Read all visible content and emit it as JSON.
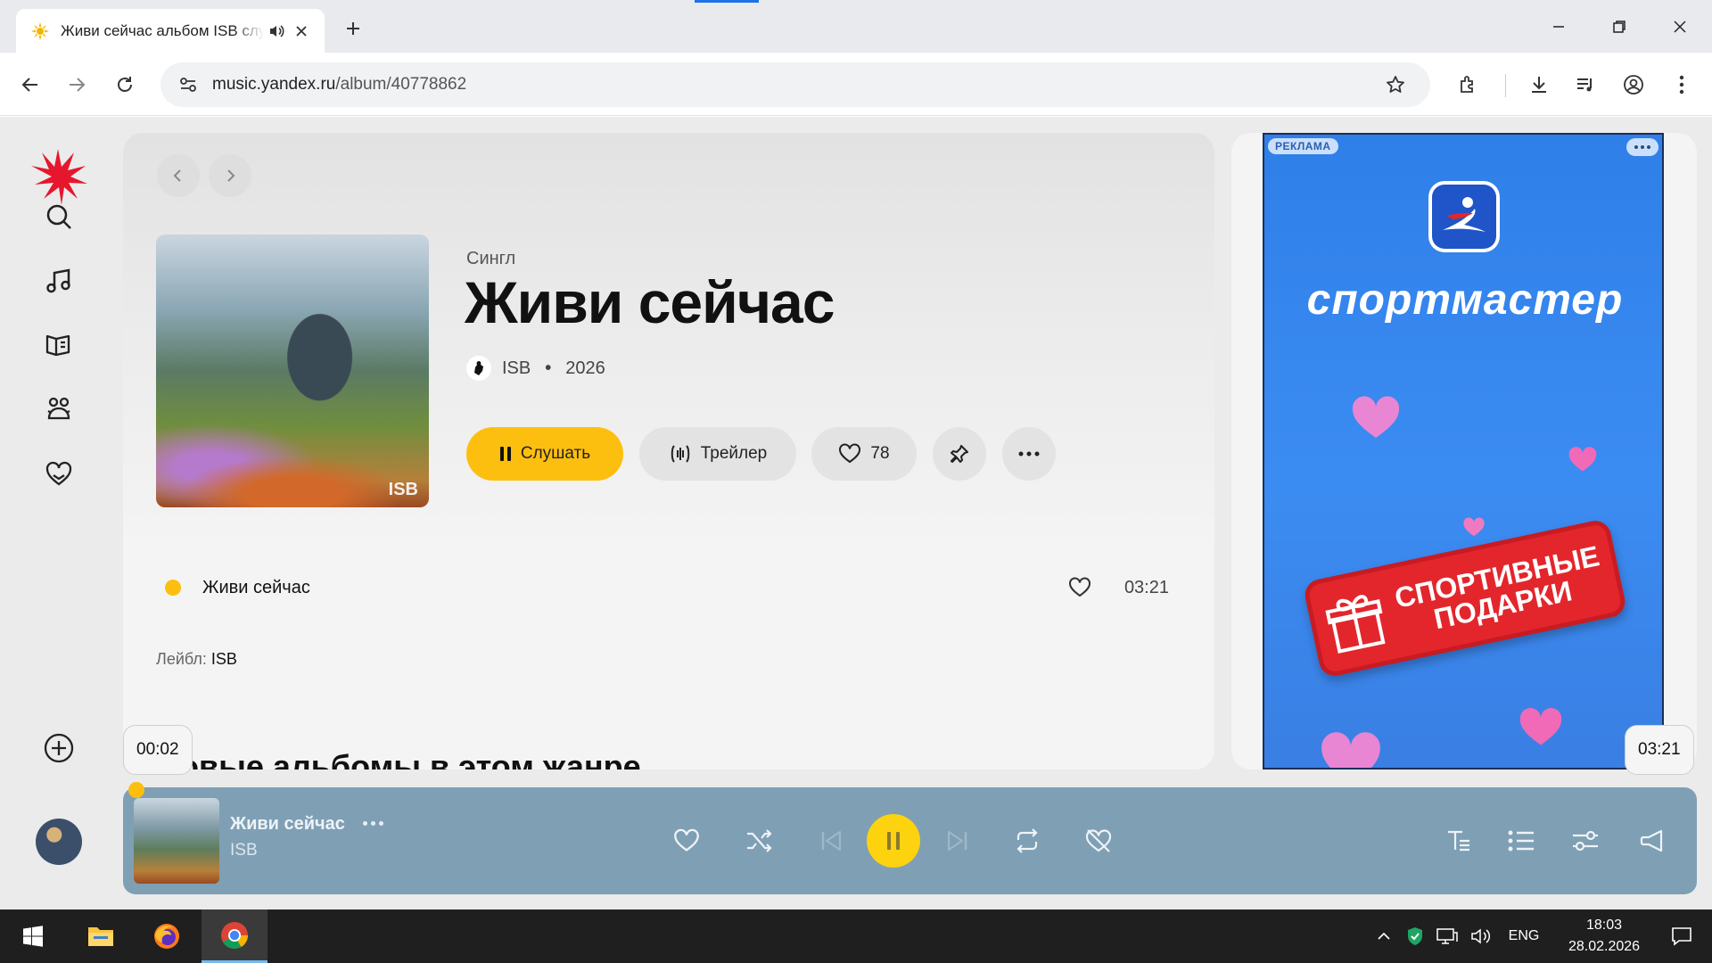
{
  "browser": {
    "tab_title": "Живи сейчас альбом ISB слушать онлайн",
    "url_host": "music.yandex.ru",
    "url_path": "/album/40778862"
  },
  "album": {
    "type_label": "Сингл",
    "title": "Живи сейчас",
    "artist": "ISB",
    "year": "2026",
    "cover_mark": "ISB",
    "buttons": {
      "play": "Слушать",
      "trailer": "Трейлер",
      "likes": "78"
    },
    "tracks": [
      {
        "name": "Живи сейчас",
        "duration": "03:21"
      }
    ],
    "label_prefix": "Лейбл:",
    "label_name": "ISB",
    "genre_heading": "Новые альбомы в этом жанре"
  },
  "ad": {
    "badge": "РЕКЛАМА",
    "brand": "спортмастер",
    "ribbon": "Спортивные подарки"
  },
  "player": {
    "track_title": "Живи сейчас",
    "artist": "ISB",
    "elapsed": "00:02",
    "total": "03:21",
    "progress_fraction": 0.01
  },
  "taskbar": {
    "lang": "ENG",
    "time": "18:03",
    "date": "28.02.2026"
  },
  "colors": {
    "accent": "#fdbf0f",
    "player_bg": "#7f9fb4",
    "ad_bg": "#3b8cf2"
  }
}
